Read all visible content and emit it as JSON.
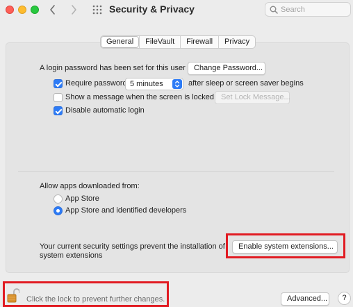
{
  "window": {
    "title": "Security & Privacy"
  },
  "search": {
    "placeholder": "Search"
  },
  "tabs": [
    {
      "label": "General",
      "active": true
    },
    {
      "label": "FileVault",
      "active": false
    },
    {
      "label": "Firewall",
      "active": false
    },
    {
      "label": "Privacy",
      "active": false
    }
  ],
  "general": {
    "login_password_text": "A login password has been set for this user",
    "change_password_button": "Change Password...",
    "require_password": {
      "label": "Require password",
      "checked": true,
      "delay_value": "5 minutes",
      "suffix": "after sleep or screen saver begins"
    },
    "show_message": {
      "label": "Show a message when the screen is locked",
      "checked": false,
      "button": "Set Lock Message..."
    },
    "disable_auto_login": {
      "label": "Disable automatic login",
      "checked": true
    }
  },
  "allow_apps": {
    "heading": "Allow apps downloaded from:",
    "options": [
      {
        "label": "App Store",
        "selected": false
      },
      {
        "label": "App Store and identified developers",
        "selected": true
      }
    ]
  },
  "extensions": {
    "message_line1": "Your current security settings prevent the installation of",
    "message_line2": "system extensions",
    "button": "Enable system extensions..."
  },
  "footer": {
    "lock_text": "Click the lock to prevent further changes.",
    "advanced_button": "Advanced...",
    "help_label": "?"
  },
  "colors": {
    "accent": "#2d7bf6",
    "highlight": "#e11b22"
  }
}
